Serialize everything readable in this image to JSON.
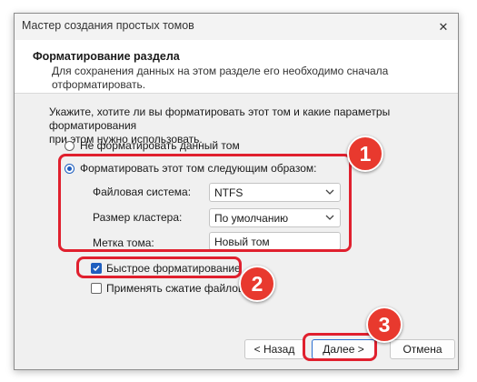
{
  "window": {
    "title": "Мастер создания простых томов",
    "close_glyph": "✕"
  },
  "header": {
    "title": "Форматирование раздела",
    "desc_line1": "Для сохранения данных на этом разделе его необходимо сначала",
    "desc_line2": "отформатировать."
  },
  "body": {
    "instr_line1": "Укажите, хотите ли вы форматировать этот том и какие параметры форматирования",
    "instr_line2": "при этом нужно использовать.",
    "radio_no_format": "Не форматировать данный том",
    "radio_format": "Форматировать этот том следующим образом:",
    "fs_label": "Файловая система:",
    "fs_value": "NTFS",
    "cluster_label": "Размер кластера:",
    "cluster_value": "По умолчанию",
    "volume_label": "Метка тома:",
    "volume_value": "Новый том",
    "quick_format": "Быстрое форматирование",
    "compression": "Применять сжатие файлов и"
  },
  "buttons": {
    "back": "< Назад",
    "next": "Далее >",
    "cancel": "Отмена"
  },
  "badges": {
    "b1": "1",
    "b2": "2",
    "b3": "3"
  },
  "colors": {
    "highlight": "#e0202e",
    "badge": "#e8392e",
    "accent": "#1f5fbf"
  }
}
